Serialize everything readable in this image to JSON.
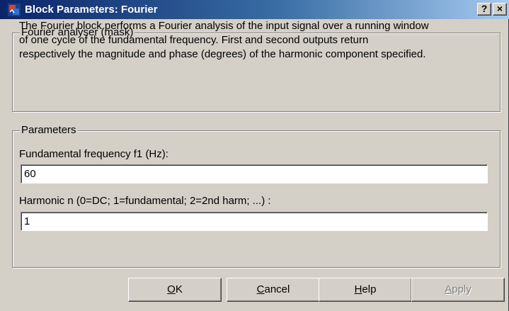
{
  "window": {
    "title": "Block Parameters: Fourier",
    "help_button": "?",
    "close_button": "×"
  },
  "mask_group": {
    "legend": "Fourier analyser (mask)",
    "description": "The Fourier block performs a Fourier analysis of the input signal over a running window\nof one cycle of the fundamental frequency. First and second outputs return\nrespectively the magnitude and phase (degrees) of the harmonic component specified."
  },
  "params_group": {
    "legend": "Parameters",
    "fundamental_label": "Fundamental frequency f1 (Hz):",
    "fundamental_value": "60",
    "harmonic_label": "Harmonic n (0=DC; 1=fundamental; 2=2nd harm;  ...) :",
    "harmonic_value": "1"
  },
  "buttons": {
    "ok": {
      "accel": "O",
      "rest": "K"
    },
    "cancel": {
      "accel": "C",
      "rest": "ancel"
    },
    "help": {
      "accel": "H",
      "rest": "elp"
    },
    "apply": {
      "accel": "A",
      "rest": "pply"
    }
  },
  "colors": {
    "titlebar_start": "#0a246a",
    "titlebar_end": "#a6caf0",
    "face": "#d4d0c8"
  }
}
